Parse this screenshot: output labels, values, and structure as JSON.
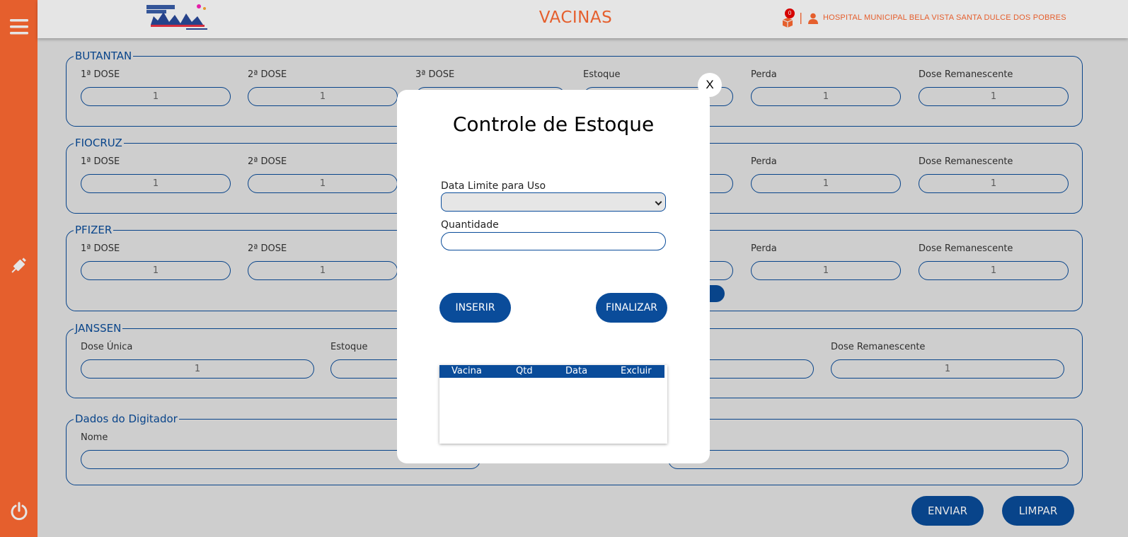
{
  "header": {
    "title": "VACINAS",
    "cart_count": "0",
    "separator": "|",
    "hospital_name": "HOSPITAL MUNICIPAL BELA VISTA SANTA DULCE DOS POBRES"
  },
  "groups": {
    "butantan": {
      "legend": "BUTANTAN",
      "labels": [
        "1ª DOSE",
        "2ª DOSE",
        "3ª DOSE",
        "Estoque",
        "Perda",
        "Dose Remanescente"
      ],
      "values": [
        "1",
        "1",
        "",
        "",
        "1",
        "1"
      ]
    },
    "fiocruz": {
      "legend": "FIOCRUZ",
      "labels": [
        "1ª DOSE",
        "2ª DOSE",
        "Perda",
        "Dose Remanescente"
      ],
      "values": [
        "1",
        "1",
        "1",
        "1"
      ]
    },
    "pfizer": {
      "legend": "PFIZER",
      "labels": [
        "1ª DOSE",
        "2ª DOSE",
        "Perda",
        "Dose Remanescente"
      ],
      "values": [
        "1",
        "1",
        "1",
        "1"
      ]
    },
    "janssen": {
      "legend": "JANSSEN",
      "labels": [
        "Dose Única",
        "Estoque",
        "Dose Remanescente"
      ],
      "values": [
        "1",
        "",
        "1"
      ]
    },
    "digitador": {
      "legend": "Dados do Digitador",
      "labels": [
        "Nome"
      ]
    }
  },
  "actions": {
    "send": "ENVIAR",
    "clear": "LIMPAR"
  },
  "modal": {
    "close": "X",
    "title": "Controle de Estoque",
    "date_label": "Data Limite para Uso",
    "date_value": "",
    "qty_label": "Quantidade",
    "qty_value": "",
    "insert": "INSERIR",
    "finish": "FINALIZAR",
    "table_headers": [
      "Vacina",
      "Qtd",
      "Data",
      "Excluir"
    ]
  },
  "colors": {
    "accent": "#ff6a33",
    "primary": "#0a4c9a",
    "background": "#e6e6e6"
  },
  "icons": {
    "menu": "hamburger-menu-icon",
    "vaccine": "syringe-icon",
    "power": "power-icon",
    "cart": "cart-icon",
    "user": "user-icon"
  }
}
